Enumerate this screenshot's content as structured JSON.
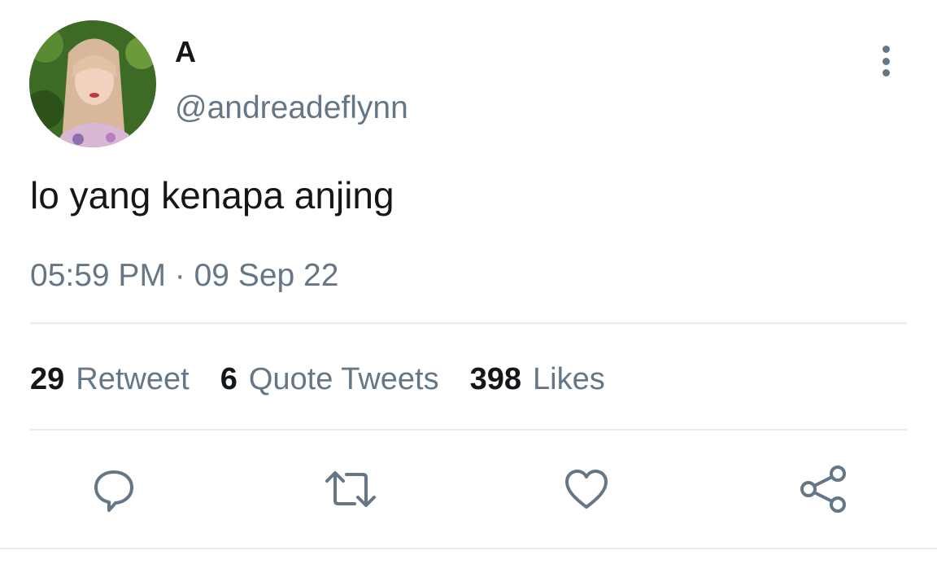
{
  "tweet": {
    "display_name": "A",
    "handle": "@andreadeflynn",
    "text": "lo yang kenapa anjing",
    "timestamp": "05:59 PM · 09 Sep 22"
  },
  "stats": {
    "retweets": {
      "count": "29",
      "label": "Retweet"
    },
    "quotes": {
      "count": "6",
      "label": "Quote Tweets"
    },
    "likes": {
      "count": "398",
      "label": "Likes"
    }
  },
  "icons": {
    "more": "more-vertical-icon",
    "reply": "reply-icon",
    "retweet": "retweet-icon",
    "like": "heart-icon",
    "share": "share-icon"
  },
  "colors": {
    "primary_text": "#14171a",
    "secondary_text": "#657786",
    "divider": "#e6ecf0"
  }
}
